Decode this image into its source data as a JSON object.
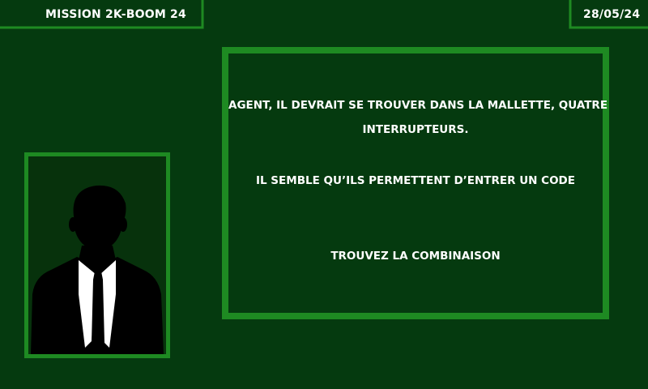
{
  "header": {
    "mission_label": "MISSION  2K-BOOM 24",
    "date_label": "28/05/24"
  },
  "portrait": {
    "icon": "agent-silhouette-icon"
  },
  "message": {
    "line1": "AGENT, IL DEVRAIT SE TROUVER DANS LA MALLETTE, QUATRE",
    "line2": "INTERRUPTEURS.",
    "line3": "IL SEMBLE QU’ILS PERMETTENT D’ENTRER UN CODE",
    "line4": "TROUVEZ LA COMBINAISON"
  },
  "colors": {
    "background": "#053a0f",
    "accent": "#1e8a22",
    "text": "#ffffff"
  }
}
